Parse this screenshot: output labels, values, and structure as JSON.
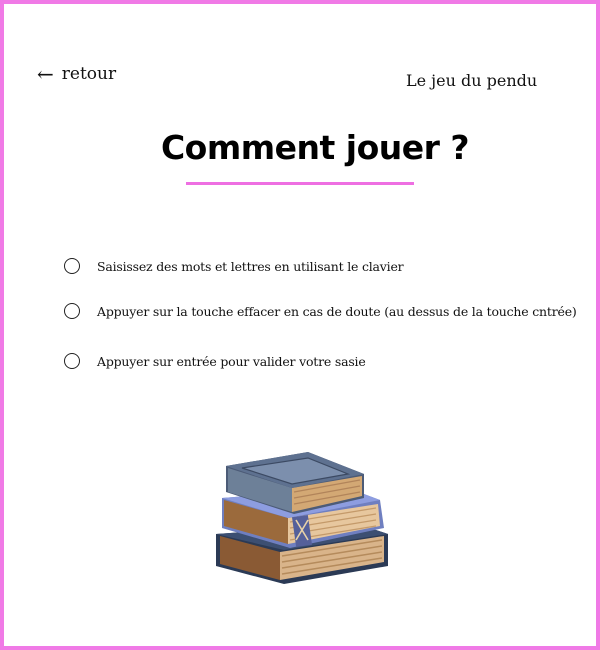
{
  "header": {
    "back_arrow": "←",
    "back_label": "retour",
    "site_title": "Le jeu du pendu"
  },
  "main": {
    "title": "Comment jouer ?",
    "rules": [
      {
        "text": "Saisissez des mots et lettres en utilisant le clavier"
      },
      {
        "text": "Appuyer sur la touche effacer en cas de doute (au dessus de la touche cntrée)"
      },
      {
        "text": "Appuyer sur entrée pour valider votre sasie"
      }
    ]
  },
  "colors": {
    "accent": "#f07ae6",
    "text": "#111111"
  },
  "illustration": {
    "icon": "books-stack-icon"
  }
}
